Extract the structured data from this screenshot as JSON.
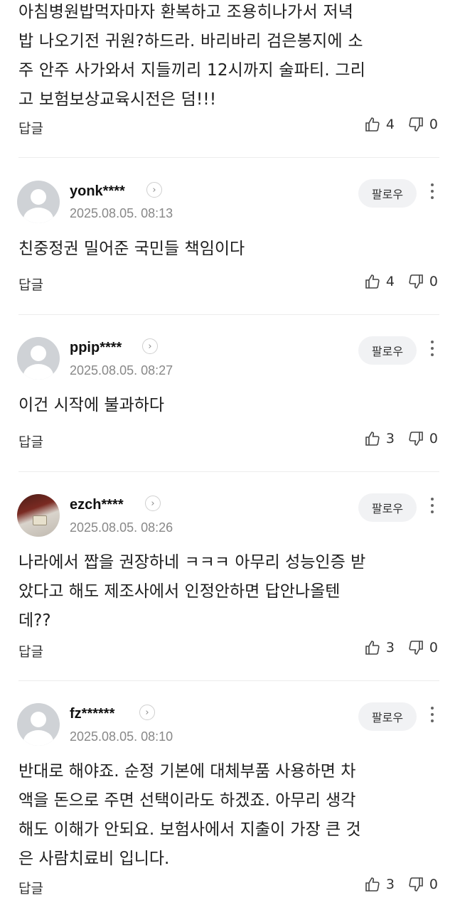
{
  "top_comment": {
    "text": "아침병원밥먹자마자 환복하고 조용히나가서 저녁\n밥 나오기전 귀원?하드라. 바리바리 검은봉지에 소\n주 안주 사가와서 지들끼리 12시까지 술파티. 그리\n고 보험보상교육시전은 덤!!!",
    "reply_label": "답글",
    "likes": "4",
    "dislikes": "0"
  },
  "comments": [
    {
      "username": "yonk****",
      "date": "2025.08.05. 08:13",
      "follow_label": "팔로우",
      "text": "친중정권 밀어준 국민들 책임이다",
      "reply_label": "답글",
      "likes": "4",
      "dislikes": "0"
    },
    {
      "username": "ppip****",
      "date": "2025.08.05. 08:27",
      "follow_label": "팔로우",
      "text": "이건 시작에 불과하다",
      "reply_label": "답글",
      "likes": "3",
      "dislikes": "0"
    },
    {
      "username": "ezch****",
      "date": "2025.08.05. 08:26",
      "follow_label": "팔로우",
      "text": "나라에서 짭을 권장하네 ㅋㅋㅋ 아무리 성능인증 받\n았다고 해도 제조사에서 인정안하면 답안나올텐\n데??",
      "reply_label": "답글",
      "likes": "3",
      "dislikes": "0"
    },
    {
      "username": "fz******",
      "date": "2025.08.05. 08:10",
      "follow_label": "팔로우",
      "text": "반대로 해야죠. 순정 기본에 대체부품 사용하면 차\n액을 돈으로 주면 선택이라도 하겠죠. 아무리 생각\n해도 이해가 안되요. 보험사에서 지출이 가장 큰 것\n은 사람치료비 입니다.",
      "reply_label": "답글",
      "likes": "3",
      "dislikes": "0"
    }
  ],
  "icons": {
    "like": "thumbs-up-icon",
    "dislike": "thumbs-down-icon",
    "more": "more-vertical-icon",
    "chevron": "chevron-right-icon"
  }
}
